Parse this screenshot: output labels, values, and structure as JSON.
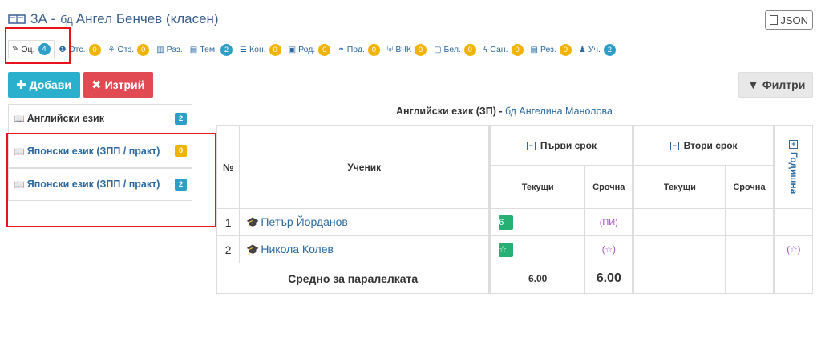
{
  "header": {
    "class_label": "3А -",
    "teacher_mark": "бд",
    "teacher_name": "Ангел Бенчев (класен)",
    "json_button": "JSON"
  },
  "tabs": [
    {
      "icon": "pencil-icon",
      "glyph": "✎",
      "label": "Оц.",
      "count": "4",
      "color": "blue"
    },
    {
      "icon": "info-icon",
      "glyph": "❶",
      "label": "Отс.",
      "count": "0",
      "color": "yellow"
    },
    {
      "icon": "award-icon",
      "glyph": "⚘",
      "label": "Отз.",
      "count": "0",
      "color": "yellow"
    },
    {
      "icon": "book-icon",
      "glyph": "▥",
      "label": "Раз.",
      "count": "",
      "color": ""
    },
    {
      "icon": "table-icon",
      "glyph": "▤",
      "label": "Тем.",
      "count": "2",
      "color": "blue"
    },
    {
      "icon": "list-icon",
      "glyph": "☰",
      "label": "Кон.",
      "count": "0",
      "color": "yellow"
    },
    {
      "icon": "calendar-icon",
      "glyph": "▣",
      "label": "Род.",
      "count": "0",
      "color": "yellow"
    },
    {
      "icon": "handshake-icon",
      "glyph": "⚭",
      "label": "Под.",
      "count": "0",
      "color": "yellow"
    },
    {
      "icon": "shield-icon",
      "glyph": "⛨",
      "label": "ВЧК",
      "count": "0",
      "color": "yellow"
    },
    {
      "icon": "note-icon",
      "glyph": "▢",
      "label": "Бел.",
      "count": "0",
      "color": "yellow"
    },
    {
      "icon": "bolt-icon",
      "glyph": "ϟ",
      "label": "Сан.",
      "count": "0",
      "color": "yellow"
    },
    {
      "icon": "file-icon",
      "glyph": "▤",
      "label": "Рез.",
      "count": "0",
      "color": "yellow"
    },
    {
      "icon": "user-icon",
      "glyph": "♟",
      "label": "Уч.",
      "count": "2",
      "color": "blue"
    }
  ],
  "toolbar": {
    "add_label": "Добави",
    "delete_label": "Изтрий",
    "filter_label": "Филтри"
  },
  "subjects": [
    {
      "label": "Английски език",
      "count": "2",
      "color": "blue"
    },
    {
      "label": "Японски език (ЗПП / практ)",
      "count": "0",
      "color": "yellow"
    },
    {
      "label": "Японски език (ЗПП / практ)",
      "count": "2",
      "color": "blue"
    }
  ],
  "table": {
    "title": "Английски език (ЗП) -",
    "teacher_mark": "бд",
    "teacher_name": "Ангелина Манолова",
    "col_num": "№",
    "col_student": "Ученик",
    "term1": "Първи срок",
    "term2": "Втори срок",
    "annual": "Годишна",
    "current": "Текущи",
    "final": "Срочна",
    "rows": [
      {
        "num": "1",
        "name": "Петър Йорданов",
        "t1_current": "6",
        "t1_final": "(ПИ)",
        "annual": ""
      },
      {
        "num": "2",
        "name": "Никола Колев",
        "t1_current": "☆",
        "t1_final": "(☆)",
        "annual": "(☆)"
      }
    ],
    "avg_label": "Средно за паралелката",
    "avg_current": "6.00",
    "avg_final": "6.00"
  }
}
